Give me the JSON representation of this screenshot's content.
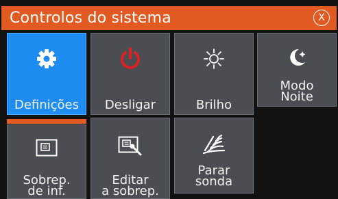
{
  "dialog": {
    "title": "Controlos do sistema",
    "close_label": "X"
  },
  "tiles": {
    "definicoes": "Definições",
    "desligar": "Desligar",
    "brilho": "Brilho",
    "modo_noite_1": "Modo",
    "modo_noite_2": "Noite",
    "sobrep_1": "Sobrep.",
    "sobrep_2": "de inf.",
    "editar_1": "Editar",
    "editar_2": "a sobrep.",
    "parar_1": "Parar",
    "parar_2": "sonda"
  },
  "colors": {
    "accent": "#e05a22",
    "tile": "#4a4e52",
    "active_tile": "#1e8cf0",
    "power_icon": "#e02020"
  }
}
